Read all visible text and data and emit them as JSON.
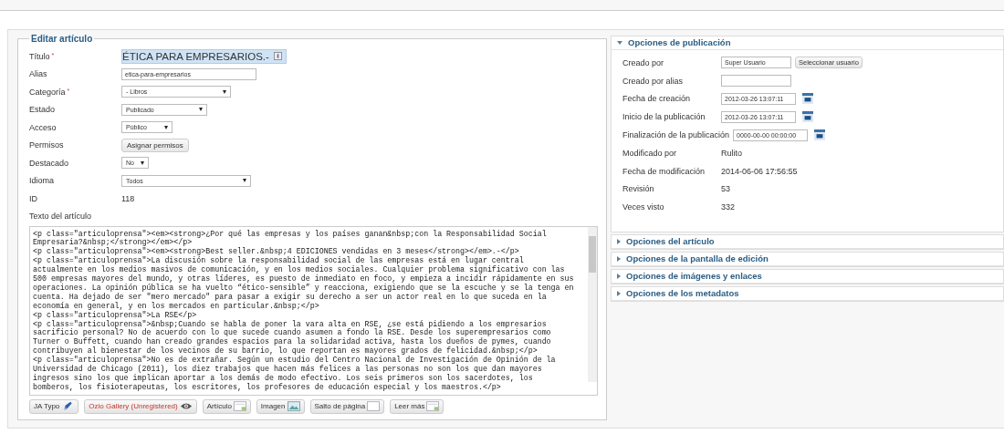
{
  "editor": {
    "legend": "Editar artículo",
    "fields": [
      {
        "label": "Título",
        "mark": "*",
        "kind": "title",
        "value": "ÉTICA PARA EMPRESARIOS.-"
      },
      {
        "label": "Alias",
        "kind": "input",
        "value": "etica-para-empresarios"
      },
      {
        "label": "Categoría",
        "mark": "*",
        "kind": "select",
        "value": "- Libros"
      },
      {
        "label": "Estado",
        "kind": "select",
        "value": "Publicado"
      },
      {
        "label": "Acceso",
        "kind": "select",
        "value": "Público"
      },
      {
        "label": "Permisos",
        "kind": "button",
        "value": "Asignar permisos"
      },
      {
        "label": "Destacado",
        "kind": "select",
        "value": "No"
      },
      {
        "label": "Idioma",
        "kind": "select",
        "value": "Todos"
      },
      {
        "label": "ID",
        "kind": "text",
        "value": "118"
      }
    ],
    "text_label": "Texto del artículo",
    "text_lines": [
      "<p class=\"articuloprensa\"><em><strong>¿Por qué las empresas y los países ganan&nbsp;con la Responsabilidad Social",
      "Empresaria?&nbsp;</strong></em></p>",
      "<p class=\"articuloprensa\"><em><strong>Best seller.&nbsp;4 EDICIONES vendidas en 3 meses</strong></em>.-</p>",
      "<p class=\"articuloprensa\">La discusión sobre la responsabilidad social de las empresas está en lugar central",
      "actualmente en los medios masivos de comunicación, y en los medios sociales. Cualquier problema significativo con las",
      "500 empresas mayores del mundo, y otras líderes, es puesto de inmediato en foco, y empieza a incidir rápidamente en sus",
      "operaciones. La opinión pública se ha vuelto “ético-sensible” y reacciona, exigiendo que se la escuche y se la tenga en",
      "cuenta. Ha dejado de ser \"mero mercado\" para pasar a exigir su derecho a ser un actor real en lo que suceda en la",
      "economía en general, y en los mercados en particular.&nbsp;</p>",
      "<p class=\"articuloprensa\">La RSE</p>",
      "<p class=\"articuloprensa\">&nbsp;Cuando se habla de poner la vara alta en RSE, ¿se está pidiendo a los empresarios",
      "sacrificio personal? No de acuerdo con lo que sucede cuando asumen a fondo la RSE. Desde los superempresarios como",
      "Turner o Buffett, cuando han creado grandes espacios para la solidaridad activa, hasta los dueños de pymes, cuando",
      "contribuyen al bienestar de los vecinos de su barrio, lo que reportan es mayores grados de felicidad.&nbsp;</p>",
      "<p class=\"articuloprensa\">No es de extrañar. Según un estudio del Centro Nacional de Investigación de Opinión de la",
      "Universidad de Chicago (2011), los diez trabajos que hacen más felices a las personas no son los que dan mayores",
      "ingresos sino los que implican aportar a los demás de modo efectivo. Los seis primeros son los sacerdotes, los",
      "bomberos, los fisioterapeutas, los escritores, los profesores de educación especial y los maestros.</p>"
    ],
    "buttons": [
      {
        "label": "JA Typo",
        "kind": "pen",
        "warning": false
      },
      {
        "label": "Ozio Gallery (Unregistered)",
        "kind": "eye",
        "warning": true
      },
      {
        "label": "Artículo",
        "kind": "doc",
        "warning": false
      },
      {
        "label": "Imagen",
        "kind": "image",
        "warning": false
      },
      {
        "label": "Salto de página",
        "kind": "page",
        "warning": false
      },
      {
        "label": "Leer más",
        "kind": "doc",
        "warning": false
      }
    ]
  },
  "options": {
    "sections": [
      {
        "title": "Opciones de publicación",
        "expanded": true,
        "rows": [
          {
            "label": "Creado por",
            "kind": "user",
            "value": "Super Usuario",
            "button": "Seleccionar usuario"
          },
          {
            "label": "Creado por alias",
            "kind": "input"
          },
          {
            "label": "Fecha de creación",
            "kind": "date",
            "value": "2012-03-26 13:07:11"
          },
          {
            "label": "Inicio de la publicación",
            "kind": "date",
            "value": "2012-03-26 13:07:11"
          },
          {
            "label": "Finalización de la publicación",
            "kind": "date",
            "value": "0000-00-00 00:00:00"
          },
          {
            "label": "Modificado por",
            "kind": "text",
            "value": "Rulito"
          },
          {
            "label": "Fecha de modificación",
            "kind": "text",
            "value": "2014-06-06 17:56:55"
          },
          {
            "label": "Revisión",
            "kind": "text",
            "value": "53"
          },
          {
            "label": "Veces visto",
            "kind": "text",
            "value": "332"
          }
        ]
      },
      {
        "title": "Opciones del artículo",
        "expanded": false
      },
      {
        "title": "Opciones de la pantalla de edición",
        "expanded": false
      },
      {
        "title": "Opciones de imágenes y enlaces",
        "expanded": false
      },
      {
        "title": "Opciones de los metadatos",
        "expanded": false
      }
    ]
  }
}
